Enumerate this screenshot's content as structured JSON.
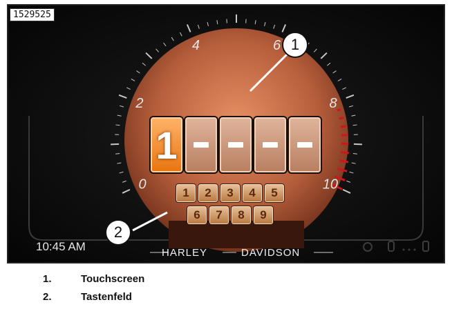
{
  "figure_id": "1529525",
  "screen": {
    "clock": "10:45 AM",
    "dial_ticks": [
      "0",
      "2",
      "4",
      "6",
      "8",
      "10"
    ],
    "pin_entry": {
      "digits": [
        "1",
        "",
        "",
        "",
        ""
      ],
      "active_index": 0
    },
    "keypad": {
      "row1": [
        "1",
        "2",
        "3",
        "4",
        "5"
      ],
      "row2": [
        "6",
        "7",
        "8",
        "9"
      ]
    },
    "brand_left": "HARLEY",
    "brand_right": "DAVIDSON",
    "accent_color": "#e8740f",
    "redline_color": "#d1141c"
  },
  "callouts": [
    "1",
    "2"
  ],
  "legend": [
    {
      "num": "1.",
      "label": "Touchscreen"
    },
    {
      "num": "2.",
      "label": "Tastenfeld"
    }
  ]
}
